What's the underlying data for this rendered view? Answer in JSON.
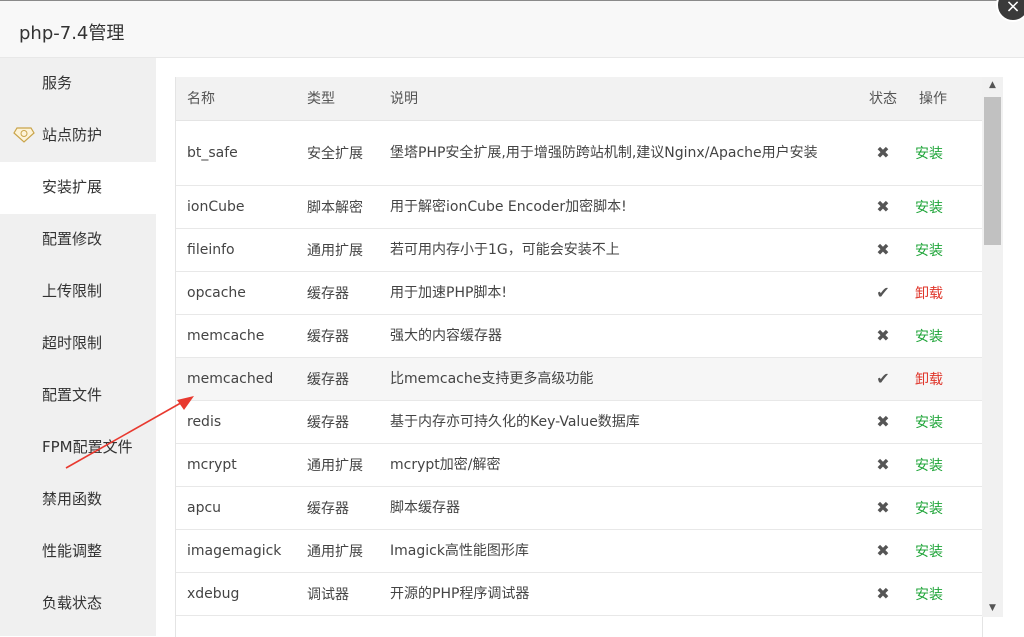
{
  "window": {
    "title": "php-7.4管理",
    "close_icon": "×"
  },
  "sidebar": {
    "items": [
      {
        "label": "服务",
        "active": false
      },
      {
        "label": "站点防护",
        "active": false,
        "icon": "gem-icon"
      },
      {
        "label": "安装扩展",
        "active": true
      },
      {
        "label": "配置修改",
        "active": false
      },
      {
        "label": "上传限制",
        "active": false
      },
      {
        "label": "超时限制",
        "active": false
      },
      {
        "label": "配置文件",
        "active": false
      },
      {
        "label": "FPM配置文件",
        "active": false
      },
      {
        "label": "禁用函数",
        "active": false
      },
      {
        "label": "性能调整",
        "active": false
      },
      {
        "label": "负载状态",
        "active": false
      }
    ]
  },
  "table": {
    "headers": {
      "name": "名称",
      "type": "类型",
      "desc": "说明",
      "status": "状态",
      "op": "操作"
    },
    "rows": [
      {
        "name": "bt_safe",
        "type": "安全扩展",
        "desc": "堡塔PHP安全扩展,用于增强防跨站机制,建议Nginx/Apache用户安装",
        "status": "✖",
        "op": "安装"
      },
      {
        "name": "ionCube",
        "type": "脚本解密",
        "desc": "用于解密ionCube Encoder加密脚本!",
        "status": "✖",
        "op": "安装"
      },
      {
        "name": "fileinfo",
        "type": "通用扩展",
        "desc": "若可用内存小于1G，可能会安装不上",
        "status": "✖",
        "op": "安装"
      },
      {
        "name": "opcache",
        "type": "缓存器",
        "desc": "用于加速PHP脚本!",
        "status": "✔",
        "op": "卸载"
      },
      {
        "name": "memcache",
        "type": "缓存器",
        "desc": "强大的内容缓存器",
        "status": "✖",
        "op": "安装"
      },
      {
        "name": "memcached",
        "type": "缓存器",
        "desc": "比memcache支持更多高级功能",
        "status": "✔",
        "op": "卸载"
      },
      {
        "name": "redis",
        "type": "缓存器",
        "desc": "基于内存亦可持久化的Key-Value数据库",
        "status": "✖",
        "op": "安装"
      },
      {
        "name": "mcrypt",
        "type": "通用扩展",
        "desc": "mcrypt加密/解密",
        "status": "✖",
        "op": "安装"
      },
      {
        "name": "apcu",
        "type": "缓存器",
        "desc": "脚本缓存器",
        "status": "✖",
        "op": "安装"
      },
      {
        "name": "imagemagick",
        "type": "通用扩展",
        "desc": "Imagick高性能图形库",
        "status": "✖",
        "op": "安装"
      },
      {
        "name": "xdebug",
        "type": "调试器",
        "desc": "开源的PHP程序调试器",
        "status": "✖",
        "op": "安装"
      }
    ]
  },
  "colors": {
    "install": "#20a53a",
    "uninstall": "#e0362b",
    "annotation_arrow": "#e8392f"
  }
}
